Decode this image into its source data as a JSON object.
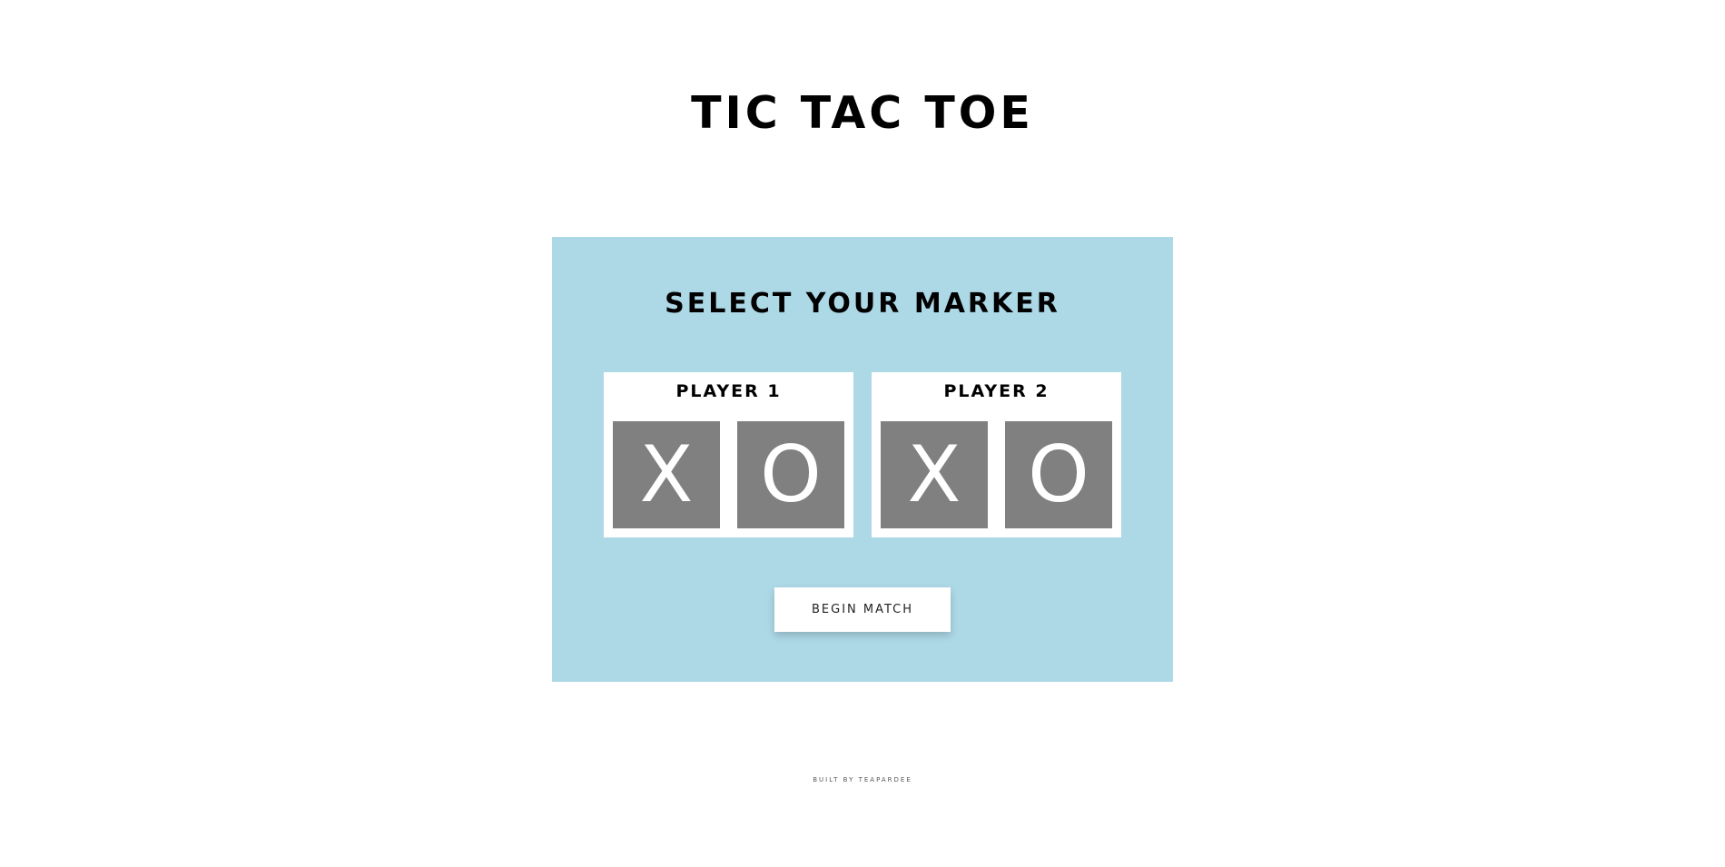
{
  "header": {
    "title": "TIC TAC TOE"
  },
  "marker_panel": {
    "heading": "SELECT YOUR MARKER",
    "background_color": "#add8e6",
    "players": [
      {
        "label": "PLAYER 1",
        "markers": [
          "X",
          "O"
        ]
      },
      {
        "label": "PLAYER 2",
        "markers": [
          "X",
          "O"
        ]
      }
    ],
    "marker_color": "#808080",
    "begin_button_label": "BEGIN MATCH"
  },
  "footer": {
    "credit": "BUILT BY TEAPARDEE"
  }
}
